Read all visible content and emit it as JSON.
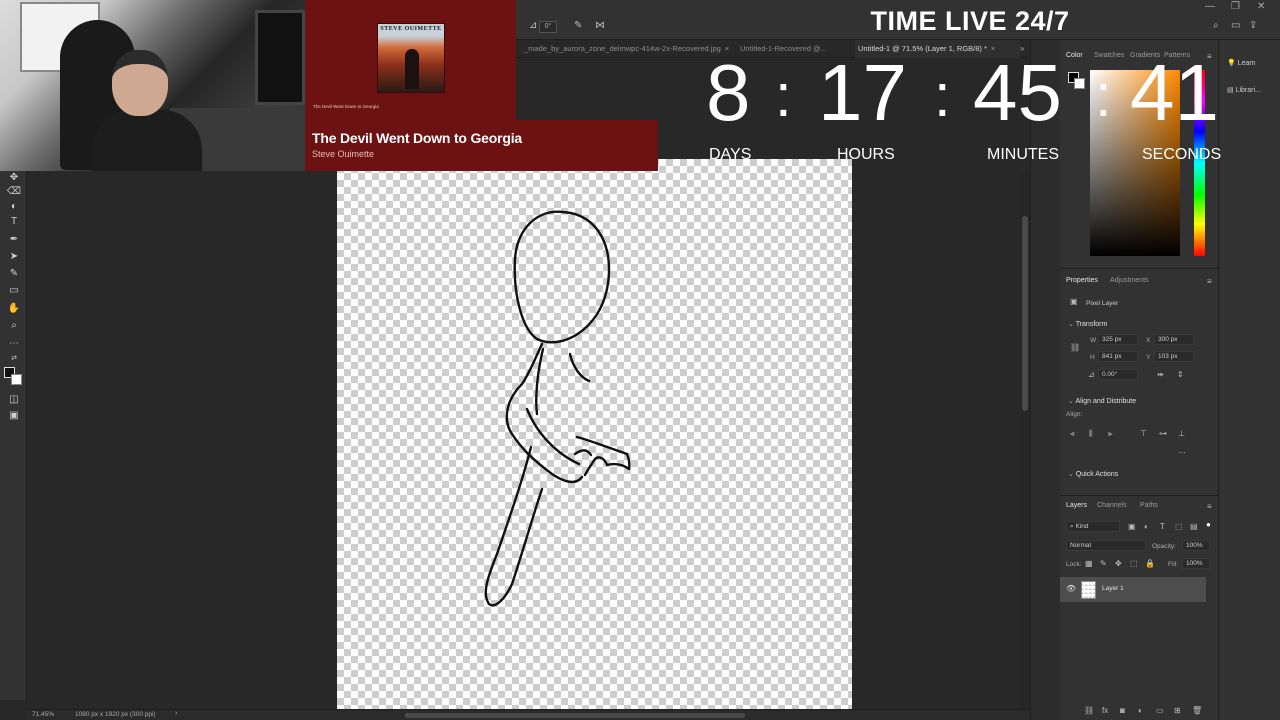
{
  "options_bar": {
    "angle_value": "0°"
  },
  "tabs": [
    {
      "label": "_made_by_aurora_zone_delmwpc-414w-2x-Recovered.jpg",
      "active": false
    },
    {
      "label": "Untitled-1-Recovered @...",
      "active": false
    },
    {
      "label": "Untitled-1 @ 71.5% (Layer 1, RGB/8) *",
      "active": true
    }
  ],
  "music": {
    "album_title": "STEVE OUIMETTE",
    "album_small_text": "The Devil Went Down to Georgia",
    "song_title": "The Devil Went Down to Georgia",
    "artist": "Steve Ouimette"
  },
  "timer": {
    "title": "TIME LIVE 24/7",
    "days": "8",
    "hours": "17",
    "minutes": "45",
    "seconds": "41",
    "days_label": "DAYS",
    "hours_label": "HOURS",
    "minutes_label": "MINUTES",
    "seconds_label": "SECONDS"
  },
  "status": {
    "zoom": "71.45%",
    "doc_info": "1080 px x 1920 px (300 ppi)"
  },
  "color_panel": {
    "tabs": [
      "Color",
      "Swatches",
      "Gradients",
      "Patterns"
    ],
    "foreground": "#000000",
    "background": "#ffffff"
  },
  "properties_panel": {
    "tabs": [
      "Properties",
      "Adjustments"
    ],
    "layer_type": "Pixel Layer",
    "transform_label": "Transform",
    "w_label": "W",
    "w_value": "325 px",
    "x_label": "X",
    "x_value": "300 px",
    "h_label": "H",
    "h_value": "841 px",
    "y_label": "Y",
    "y_value": "103 px",
    "angle_value": "0.00°",
    "align_label": "Align and Distribute",
    "align_sub": "Align:",
    "quick_actions": "Quick Actions"
  },
  "layers_panel": {
    "tabs": [
      "Layers",
      "Channels",
      "Paths"
    ],
    "kind_filter": "Kind",
    "blend_mode": "Normal",
    "opacity_label": "Opacity:",
    "opacity_value": "100%",
    "lock_label": "Lock:",
    "fill_label": "Fill:",
    "fill_value": "100%",
    "layers": [
      {
        "name": "Layer 1",
        "visible": true
      }
    ]
  },
  "far_right": {
    "learn": "Learn",
    "libraries": "Librari..."
  }
}
